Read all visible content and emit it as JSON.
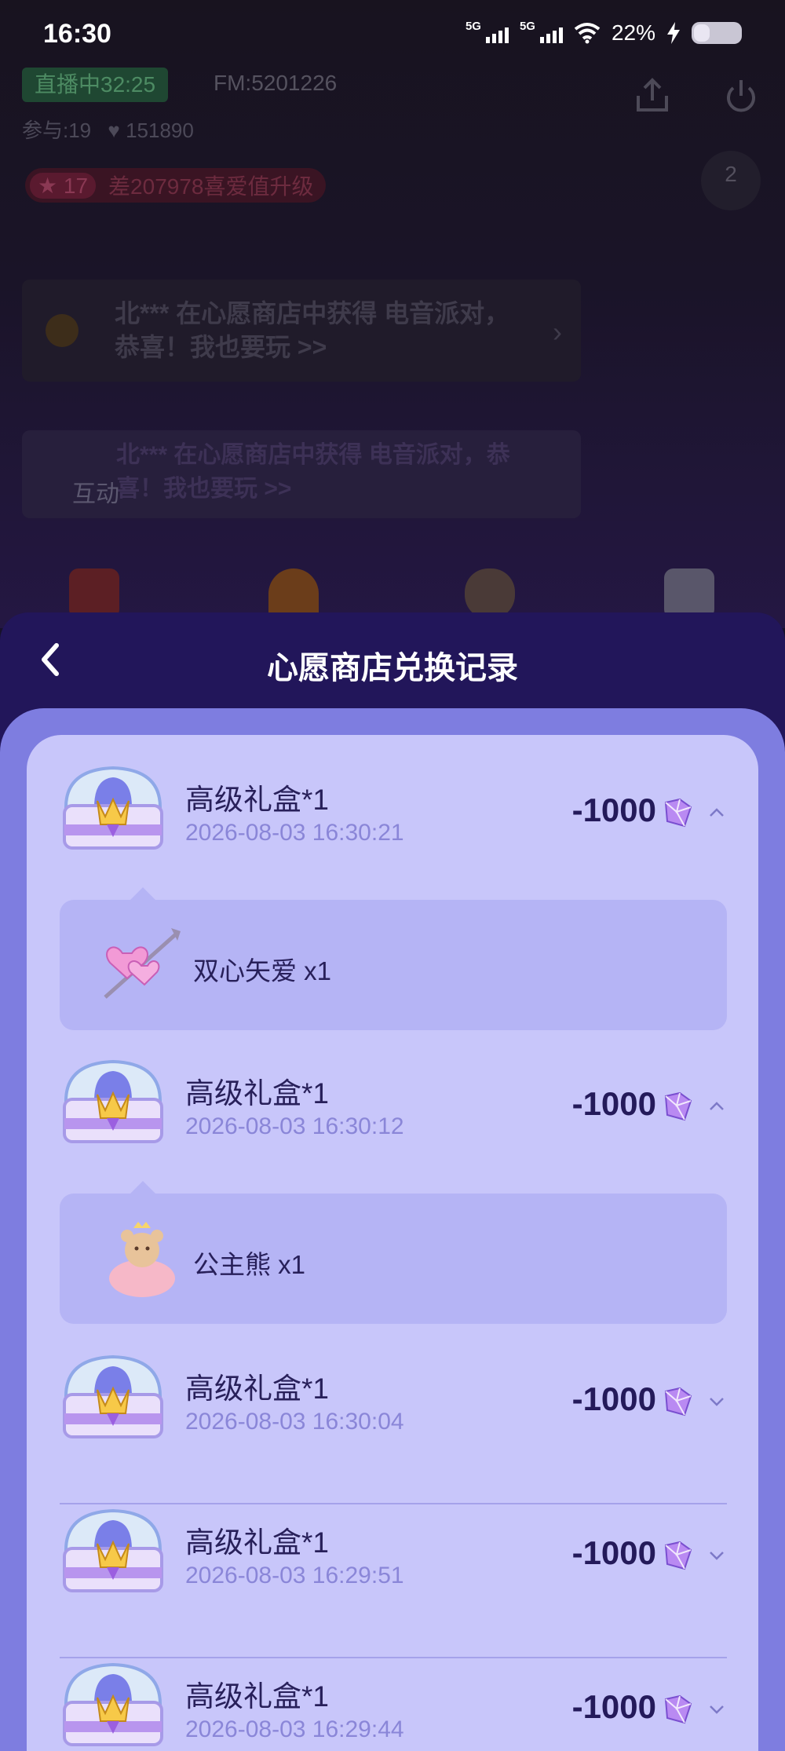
{
  "status_bar": {
    "time": "16:30",
    "network1": "5G",
    "network2": "5G",
    "battery": "22%"
  },
  "room": {
    "live_badge": "直播中32:25",
    "fm": "FM:5201226",
    "participants": "参与:19",
    "likes": "151890",
    "level": "17",
    "level_hint": "差207978喜爱值升级",
    "rank": "2",
    "notice": "北*** 在心愿商店中获得 电音派对，恭喜！我也要玩 >>",
    "notice_faded": "北*** 在心愿商店中获得 电音派对，恭喜！我也要玩 >>",
    "interact_label": "互动"
  },
  "sheet": {
    "title": "心愿商店兑换记录",
    "records": [
      {
        "name": "高级礼盒*1",
        "time": "2026-08-03 16:30:21",
        "cost": "-1000",
        "expanded": true,
        "detail": "双心矢爱 x1",
        "detail_icon": "double-heart-arrow-icon"
      },
      {
        "name": "高级礼盒*1",
        "time": "2026-08-03 16:30:12",
        "cost": "-1000",
        "expanded": true,
        "detail": "公主熊 x1",
        "detail_icon": "princess-bear-icon"
      },
      {
        "name": "高级礼盒*1",
        "time": "2026-08-03 16:30:04",
        "cost": "-1000",
        "expanded": false
      },
      {
        "name": "高级礼盒*1",
        "time": "2026-08-03 16:29:51",
        "cost": "-1000",
        "expanded": false
      },
      {
        "name": "高级礼盒*1",
        "time": "2026-08-03 16:29:44",
        "cost": "-1000",
        "expanded": false
      }
    ]
  },
  "colors": {
    "sheet_header": "#22165a",
    "panel": "#7e7de0",
    "card": "#c8c6fa",
    "detail": "#b5b4f5",
    "accent_text": "#28205a"
  }
}
